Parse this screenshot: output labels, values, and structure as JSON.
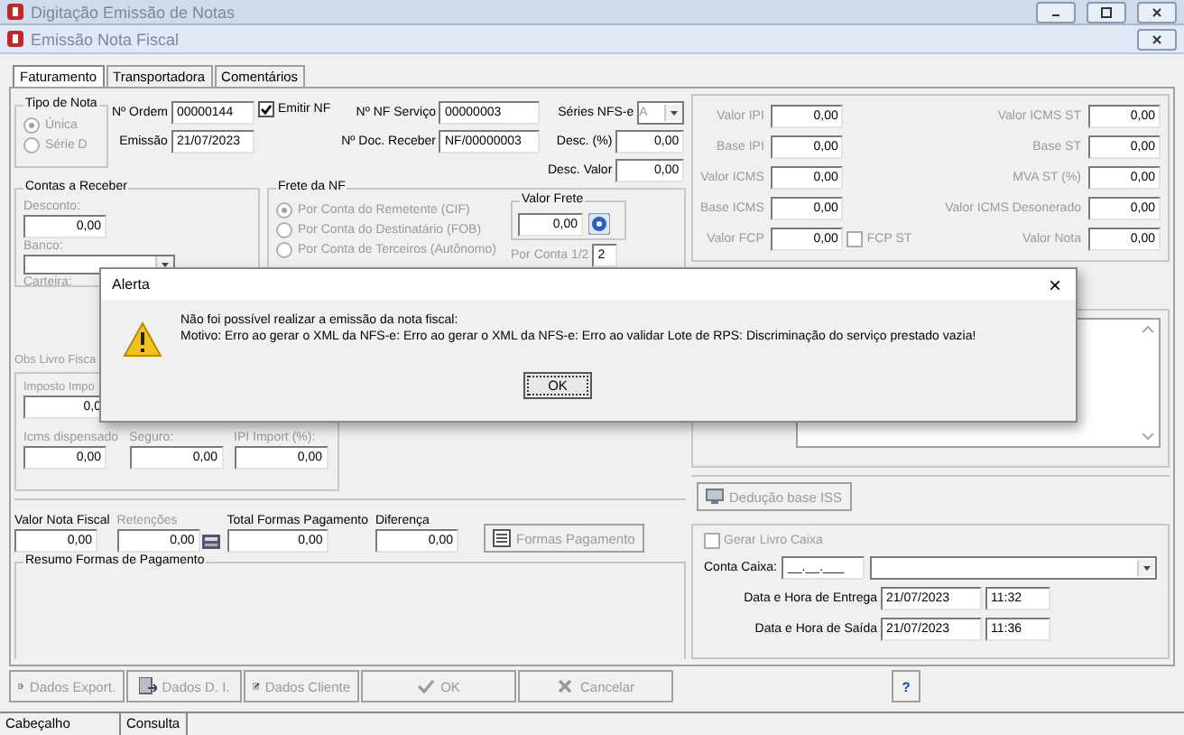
{
  "outer_window": {
    "title": "Digitação Emissão de Notas"
  },
  "window": {
    "title": "Emissão Nota Fiscal"
  },
  "tabs": [
    {
      "label": "Faturamento",
      "selected": true
    },
    {
      "label": "Transportadora",
      "selected": false
    },
    {
      "label": "Comentários",
      "selected": false
    }
  ],
  "tipo_nota": {
    "title": "Tipo de Nota",
    "options": [
      {
        "label": "Única",
        "selected": true,
        "disabled": true
      },
      {
        "label": "Série D",
        "selected": false,
        "disabled": true
      }
    ]
  },
  "header_fields": [
    {
      "label": "Nº Ordem",
      "value": "00000144"
    },
    {
      "label": "Emissão",
      "value": "21/07/2023"
    }
  ],
  "emitir_nf": {
    "label": "Emitir NF",
    "checked": true
  },
  "nf_fields": [
    {
      "label": "Nº NF Serviço",
      "value": "00000003"
    },
    {
      "label": "Nº Doc. Receber",
      "value": "NF/00000003"
    }
  ],
  "series": {
    "label": "Séries NFS-e",
    "value": "A"
  },
  "desc_fields": [
    {
      "label": "Desc. (%)",
      "value": "0,00"
    },
    {
      "label": "Desc. Valor",
      "value": "0,00"
    }
  ],
  "contas_receber": {
    "title": "Contas a Receber",
    "desconto_label": "Desconto:",
    "desconto": "0,00",
    "banco_label": "Banco:",
    "carteira_label": "Carteira:"
  },
  "frete": {
    "title": "Frete da NF",
    "options": [
      {
        "label": "Por Conta do Remetente (CIF)",
        "selected": true,
        "disabled": true
      },
      {
        "label": "Por Conta do Destinatário (FOB)",
        "selected": false,
        "disabled": true
      },
      {
        "label": "Por Conta de Terceiros (Autônomo)",
        "selected": false,
        "disabled": true
      }
    ],
    "valor_frete_label": "Valor Frete",
    "valor_frete": "0,00",
    "por_conta_label": "Por Conta 1/2",
    "por_conta": "2"
  },
  "obs_label": "Obs Livro Fisca",
  "impostos": [
    {
      "label": "Imposto Impo",
      "value": "0,0"
    },
    {
      "label": "Icms dispensado",
      "value": "0,00"
    },
    {
      "label": "Seguro:",
      "value": "0,00"
    },
    {
      "label": "IPI Import (%):",
      "value": "0,00"
    }
  ],
  "totals": [
    {
      "label": "Valor Nota Fiscal",
      "value": "0,00",
      "disabled": false
    },
    {
      "label": "Retenções",
      "value": "0,00",
      "disabled": true
    },
    {
      "label": "Total Formas Pagamento",
      "value": "0,00",
      "disabled": false
    },
    {
      "label": "Diferença",
      "value": "0,00",
      "disabled": false
    }
  ],
  "formas_button": "Formas Pagamento",
  "resumo_title": "Resumo Formas de Pagamento",
  "taxes_left": [
    {
      "label": "Valor IPI",
      "value": "0,00"
    },
    {
      "label": "Base IPI",
      "value": "0,00"
    },
    {
      "label": "Valor ICMS",
      "value": "0,00"
    },
    {
      "label": "Base ICMS",
      "value": "0,00"
    },
    {
      "label": "Valor FCP",
      "value": "0,00"
    }
  ],
  "taxes_right": [
    {
      "label": "Valor ICMS ST",
      "value": "0,00"
    },
    {
      "label": "Base ST",
      "value": "0,00"
    },
    {
      "label": "MVA ST (%)",
      "value": "0,00"
    },
    {
      "label": "Valor ICMS Desonerado",
      "value": "0,00"
    },
    {
      "label": "Valor Nota",
      "value": "0,00"
    }
  ],
  "fcp_st": {
    "label": "FCP ST",
    "checked": false
  },
  "deducao_button": "Dedução base ISS",
  "caixa": {
    "gerar_label": "Gerar Livro Caixa",
    "checked": false,
    "conta_label": "Conta Caixa:",
    "conta_mask": "__.__.___",
    "entrega_label": "Data e Hora de Entrega",
    "entrega_date": "21/07/2023",
    "entrega_time": "11:32",
    "saida_label": "Data e Hora de Saída",
    "saida_date": "21/07/2023",
    "saida_time": "11:36"
  },
  "toolbar": [
    {
      "label": "Dados Export.",
      "kind": "export",
      "disabled": true
    },
    {
      "label": "Dados D. I.",
      "kind": "import",
      "disabled": true
    },
    {
      "label": "Dados Cliente",
      "kind": "edit",
      "disabled": true
    },
    {
      "label": "OK",
      "kind": "ok",
      "disabled": true
    },
    {
      "label": "Cancelar",
      "kind": "cancel",
      "disabled": true
    }
  ],
  "help_button": "?",
  "status_bar": [
    "Cabeçalho",
    "Consulta"
  ],
  "dialog": {
    "title": "Alerta",
    "close": "×",
    "lines": [
      "Não foi possível realizar a emissão da nota fiscal:",
      "Motivo: Erro ao gerar o XML da NFS-e: Erro ao gerar o XML da NFS-e: Erro ao validar Lote de RPS: Discriminação do serviço prestado vazia!"
    ],
    "ok": "OK"
  }
}
